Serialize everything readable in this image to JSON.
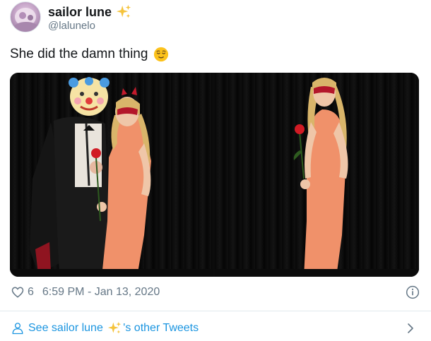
{
  "author": {
    "display_name": "sailor lune",
    "handle": "@lalunelo",
    "name_emoji": "sparkles"
  },
  "tweet": {
    "text": "She did the damn thing",
    "emoji": "relieved-face"
  },
  "media": {
    "photo_count": 2
  },
  "meta": {
    "likes": "6",
    "timestamp": "6:59 PM - Jan 13, 2020"
  },
  "footer": {
    "link_prefix": "See sailor lune ",
    "link_suffix": "'s other Tweets"
  },
  "colors": {
    "link": "#1b95e0",
    "secondary_text": "#657786",
    "primary_text": "#14171a",
    "divider": "#e1e8ed"
  },
  "icons": [
    "avatar",
    "sparkles-icon",
    "relieved-face-icon",
    "heart-icon",
    "info-icon",
    "person-icon",
    "chevron-right-icon"
  ]
}
